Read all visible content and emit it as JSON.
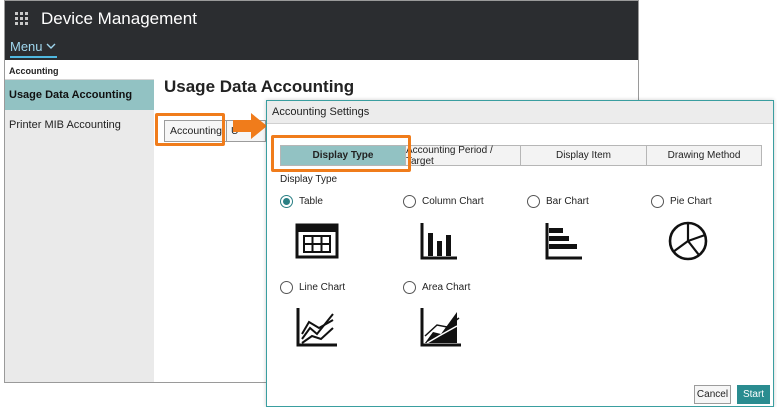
{
  "app": {
    "title": "Device Management",
    "menu_label": "Menu"
  },
  "sidebar": {
    "heading": "Accounting",
    "items": [
      {
        "label": "Usage Data Accounting",
        "active": true
      },
      {
        "label": "Printer MIB Accounting",
        "active": false
      }
    ]
  },
  "main": {
    "page_title": "Usage Data Accounting",
    "accounting_button": "Accounting",
    "second_button_partial": "U"
  },
  "dialog": {
    "title": "Accounting Settings",
    "tabs": [
      {
        "label": "Display Type",
        "active": true
      },
      {
        "label": "Accounting Period / Target",
        "active": false
      },
      {
        "label": "Display Item",
        "active": false
      },
      {
        "label": "Drawing Method",
        "active": false
      }
    ],
    "section_label": "Display Type",
    "options": [
      {
        "label": "Table",
        "checked": true,
        "icon": "table-icon"
      },
      {
        "label": "Column Chart",
        "checked": false,
        "icon": "column-chart-icon"
      },
      {
        "label": "Bar Chart",
        "checked": false,
        "icon": "bar-chart-icon"
      },
      {
        "label": "Pie Chart",
        "checked": false,
        "icon": "pie-chart-icon"
      },
      {
        "label": "Line Chart",
        "checked": false,
        "icon": "line-chart-icon"
      },
      {
        "label": "Area Chart",
        "checked": false,
        "icon": "area-chart-icon"
      }
    ],
    "cancel_label": "Cancel",
    "start_label": "Start"
  },
  "colors": {
    "titlebar": "#2b2d30",
    "accent_teal": "#92c2c3",
    "primary_button": "#2a8c90",
    "highlight_orange": "#f07c1b",
    "menu_underline": "#4fb8e0"
  }
}
